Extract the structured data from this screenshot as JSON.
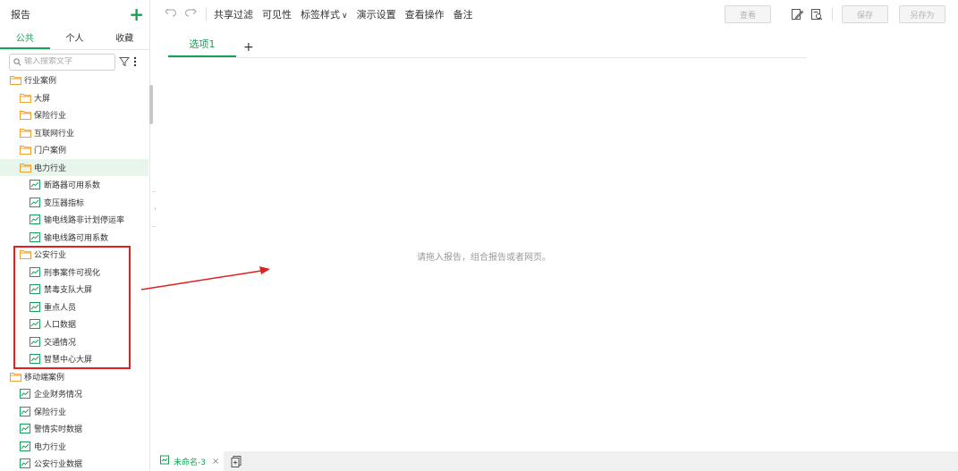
{
  "sidebar": {
    "title": "报告",
    "tabs": [
      "公共",
      "个人",
      "收藏"
    ],
    "search_placeholder": "输入搜索文字",
    "tree": [
      {
        "label": "行业案例",
        "type": "folder",
        "level": 0
      },
      {
        "label": "大屏",
        "type": "folder",
        "level": 1
      },
      {
        "label": "保险行业",
        "type": "folder",
        "level": 1
      },
      {
        "label": "互联网行业",
        "type": "folder",
        "level": 1
      },
      {
        "label": "门户案例",
        "type": "folder",
        "level": 1
      },
      {
        "label": "电力行业",
        "type": "folder",
        "level": 1,
        "selected": true
      },
      {
        "label": "断路器可用系数",
        "type": "report",
        "level": 2
      },
      {
        "label": "变压器指标",
        "type": "report",
        "level": 2
      },
      {
        "label": "输电线路非计划停运率",
        "type": "report",
        "level": 2
      },
      {
        "label": "输电线路可用系数",
        "type": "report",
        "level": 2
      },
      {
        "label": "公安行业",
        "type": "folder",
        "level": 1
      },
      {
        "label": "刑事案件可视化",
        "type": "report",
        "level": 2
      },
      {
        "label": "禁毒支队大屏",
        "type": "report",
        "level": 2
      },
      {
        "label": "重点人员",
        "type": "report",
        "level": 2
      },
      {
        "label": "人口数据",
        "type": "report",
        "level": 2
      },
      {
        "label": "交通情况",
        "type": "report",
        "level": 2
      },
      {
        "label": "智慧中心大屏",
        "type": "report",
        "level": 2
      },
      {
        "label": "移动端案例",
        "type": "folder",
        "level": 0
      },
      {
        "label": "企业财务情况",
        "type": "report",
        "level": 1
      },
      {
        "label": "保险行业",
        "type": "report",
        "level": 1
      },
      {
        "label": "警情实时数据",
        "type": "report",
        "level": 1
      },
      {
        "label": "电力行业",
        "type": "report",
        "level": 1
      },
      {
        "label": "公安行业数据",
        "type": "report",
        "level": 1
      }
    ]
  },
  "toolbar": {
    "items": [
      "共享过滤",
      "可见性",
      "标签样式",
      "演示设置",
      "查看操作",
      "备注"
    ],
    "view_label": "查看",
    "save_label": "保存",
    "save_as_label": "另存为"
  },
  "content": {
    "tab_label": "选项1",
    "add_tab": "+",
    "placeholder": "请拖入报告，组合报告或者网页。"
  },
  "bottombar": {
    "file_tab_label": "未命名-3",
    "close_glyph": "×"
  },
  "colors": {
    "accent": "#18a058",
    "folder": "#f0a030",
    "annotation": "#e02020"
  }
}
